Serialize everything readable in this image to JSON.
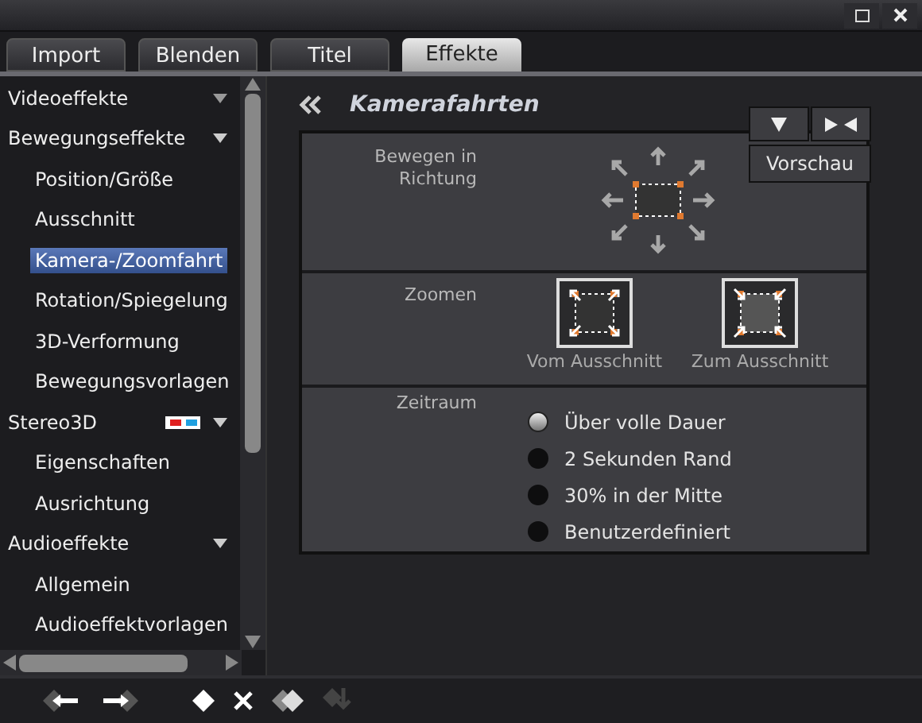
{
  "tabs": [
    {
      "label": "Import",
      "selected": false
    },
    {
      "label": "Blenden",
      "selected": false
    },
    {
      "label": "Titel",
      "selected": false
    },
    {
      "label": "Effekte",
      "selected": true
    }
  ],
  "sidebar": {
    "items": [
      {
        "label": "Videoeffekte",
        "expanded": false,
        "selected": false
      },
      {
        "label": "Bewegungseffekte",
        "expanded": true,
        "selected": false,
        "children": [
          {
            "label": "Position/Größe",
            "selected": false
          },
          {
            "label": "Ausschnitt",
            "selected": false
          },
          {
            "label": "Kamera-/Zoomfahrt",
            "selected": true
          },
          {
            "label": "Rotation/Spiegelung",
            "selected": false
          },
          {
            "label": "3D-Verformung",
            "selected": false
          },
          {
            "label": "Bewegungsvorlagen",
            "selected": false
          }
        ]
      },
      {
        "label": "Stereo3D",
        "expanded": true,
        "selected": false,
        "kind": "stereo",
        "children": [
          {
            "label": "Eigenschaften",
            "selected": false
          },
          {
            "label": "Ausrichtung",
            "selected": false
          }
        ]
      },
      {
        "label": "Audioeffekte",
        "expanded": true,
        "selected": false,
        "children": [
          {
            "label": "Allgemein",
            "selected": false
          },
          {
            "label": "Audioeffektvorlagen",
            "selected": false
          }
        ]
      }
    ]
  },
  "panel": {
    "title": "Kamerafahrten",
    "preview_button": "Vorschau",
    "move": {
      "label": "Bewegen in Richtung"
    },
    "zoom": {
      "label": "Zoomen",
      "options": [
        {
          "label": "Vom Ausschnitt",
          "kind": "out"
        },
        {
          "label": "Zum Ausschnitt",
          "kind": "in"
        }
      ]
    },
    "timespan": {
      "label": "Zeitraum",
      "options": [
        {
          "label": "Über volle Dauer",
          "selected": true
        },
        {
          "label": "2 Sekunden Rand",
          "selected": false
        },
        {
          "label": "30% in der Mitte",
          "selected": false
        },
        {
          "label": "Benutzerdefiniert",
          "selected": false
        }
      ]
    }
  }
}
